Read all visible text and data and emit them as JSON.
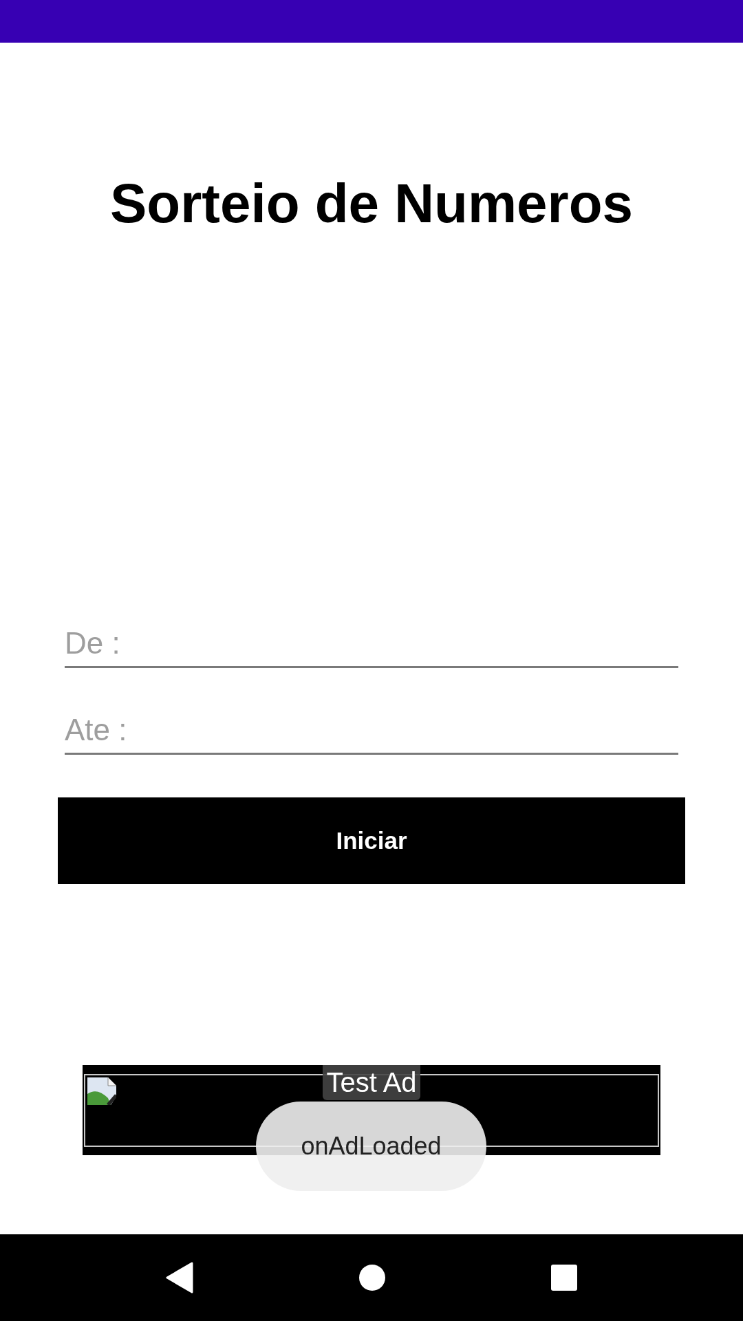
{
  "title": "Sorteio de Numeros",
  "fields": [
    {
      "placeholder": "De :"
    },
    {
      "placeholder": "Ate :"
    }
  ],
  "button": {
    "label": "Iniciar"
  },
  "ad": {
    "badge": "Test Ad"
  },
  "toast": {
    "text": "onAdLoaded"
  }
}
